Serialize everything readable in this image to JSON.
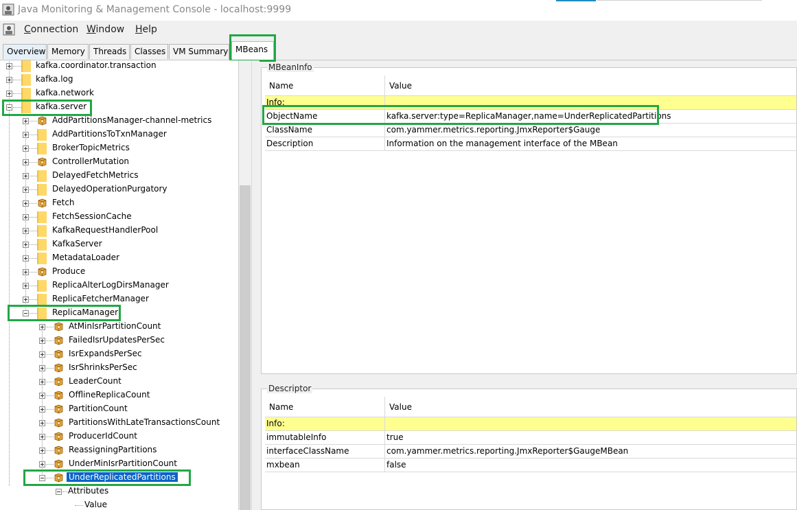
{
  "window": {
    "title": "Java Monitoring & Management Console - localhost:9999"
  },
  "menu": [
    {
      "mnemonic": "C",
      "rest": "onnection"
    },
    {
      "mnemonic": "W",
      "rest": "indow"
    },
    {
      "mnemonic": "H",
      "rest": "elp"
    }
  ],
  "tabs": [
    "Overview",
    "Memory",
    "Threads",
    "Classes",
    "VM Summary",
    "MBeans"
  ],
  "active_tab": "MBeans",
  "tree": [
    {
      "label": "kafka.coordinator.transaction",
      "icon": "folder-icon",
      "level": 0,
      "expanded": false
    },
    {
      "label": "kafka.log",
      "icon": "folder-icon",
      "level": 0,
      "expanded": false
    },
    {
      "label": "kafka.network",
      "icon": "folder-icon",
      "level": 0,
      "expanded": false
    },
    {
      "label": "kafka.server",
      "icon": "folder-icon",
      "level": 0,
      "expanded": true
    },
    {
      "label": "AddPartitionsManager-channel-metrics",
      "icon": "mbean-icon",
      "level": 1,
      "expanded": false
    },
    {
      "label": "AddPartitionsToTxnManager",
      "icon": "folder-icon",
      "level": 1,
      "expanded": false
    },
    {
      "label": "BrokerTopicMetrics",
      "icon": "folder-icon",
      "level": 1,
      "expanded": false
    },
    {
      "label": "ControllerMutation",
      "icon": "mbean-icon",
      "level": 1,
      "expanded": false
    },
    {
      "label": "DelayedFetchMetrics",
      "icon": "folder-icon",
      "level": 1,
      "expanded": false
    },
    {
      "label": "DelayedOperationPurgatory",
      "icon": "folder-icon",
      "level": 1,
      "expanded": false
    },
    {
      "label": "Fetch",
      "icon": "mbean-icon",
      "level": 1,
      "expanded": false
    },
    {
      "label": "FetchSessionCache",
      "icon": "folder-icon",
      "level": 1,
      "expanded": false
    },
    {
      "label": "KafkaRequestHandlerPool",
      "icon": "folder-icon",
      "level": 1,
      "expanded": false
    },
    {
      "label": "KafkaServer",
      "icon": "folder-icon",
      "level": 1,
      "expanded": false
    },
    {
      "label": "MetadataLoader",
      "icon": "folder-icon",
      "level": 1,
      "expanded": false
    },
    {
      "label": "Produce",
      "icon": "mbean-icon",
      "level": 1,
      "expanded": false
    },
    {
      "label": "ReplicaAlterLogDirsManager",
      "icon": "folder-icon",
      "level": 1,
      "expanded": false
    },
    {
      "label": "ReplicaFetcherManager",
      "icon": "folder-icon",
      "level": 1,
      "expanded": false
    },
    {
      "label": "ReplicaManager",
      "icon": "folder-icon",
      "level": 1,
      "expanded": true
    },
    {
      "label": "AtMinIsrPartitionCount",
      "icon": "mbean-icon",
      "level": 2,
      "expanded": false
    },
    {
      "label": "FailedIsrUpdatesPerSec",
      "icon": "mbean-icon",
      "level": 2,
      "expanded": false
    },
    {
      "label": "IsrExpandsPerSec",
      "icon": "mbean-icon",
      "level": 2,
      "expanded": false
    },
    {
      "label": "IsrShrinksPerSec",
      "icon": "mbean-icon",
      "level": 2,
      "expanded": false
    },
    {
      "label": "LeaderCount",
      "icon": "mbean-icon",
      "level": 2,
      "expanded": false
    },
    {
      "label": "OfflineReplicaCount",
      "icon": "mbean-icon",
      "level": 2,
      "expanded": false
    },
    {
      "label": "PartitionCount",
      "icon": "mbean-icon",
      "level": 2,
      "expanded": false
    },
    {
      "label": "PartitionsWithLateTransactionsCount",
      "icon": "mbean-icon",
      "level": 2,
      "expanded": false
    },
    {
      "label": "ProducerIdCount",
      "icon": "mbean-icon",
      "level": 2,
      "expanded": false
    },
    {
      "label": "ReassigningPartitions",
      "icon": "mbean-icon",
      "level": 2,
      "expanded": false
    },
    {
      "label": "UnderMinIsrPartitionCount",
      "icon": "mbean-icon",
      "level": 2,
      "expanded": false
    },
    {
      "label": "UnderReplicatedPartitions",
      "icon": "mbean-icon",
      "level": 2,
      "expanded": true,
      "selected": true
    },
    {
      "label": "Attributes",
      "icon": "none",
      "level": 3,
      "expanded": true
    },
    {
      "label": "Value",
      "icon": "none",
      "level": 4,
      "leaf": true
    }
  ],
  "mbeaninfo": {
    "title": "MBeanInfo",
    "columns": [
      "Name",
      "Value"
    ],
    "rows": [
      {
        "name": "Info:",
        "value": "",
        "info": true
      },
      {
        "name": "ObjectName",
        "value": "kafka.server:type=ReplicaManager,name=UnderReplicatedPartitions"
      },
      {
        "name": "ClassName",
        "value": "com.yammer.metrics.reporting.JmxReporter$Gauge"
      },
      {
        "name": "Description",
        "value": "Information on the management interface of the MBean"
      }
    ]
  },
  "descriptor": {
    "title": "Descriptor",
    "columns": [
      "Name",
      "Value"
    ],
    "rows": [
      {
        "name": "Info:",
        "value": "",
        "info": true
      },
      {
        "name": "immutableInfo",
        "value": "true"
      },
      {
        "name": "interfaceClassName",
        "value": "com.yammer.metrics.reporting.JmxReporter$GaugeMBean"
      },
      {
        "name": "mxbean",
        "value": "false"
      }
    ]
  },
  "colors": {
    "highlight": "#21a745",
    "info_row": "#ffff90",
    "selection": "#0a64c8"
  }
}
